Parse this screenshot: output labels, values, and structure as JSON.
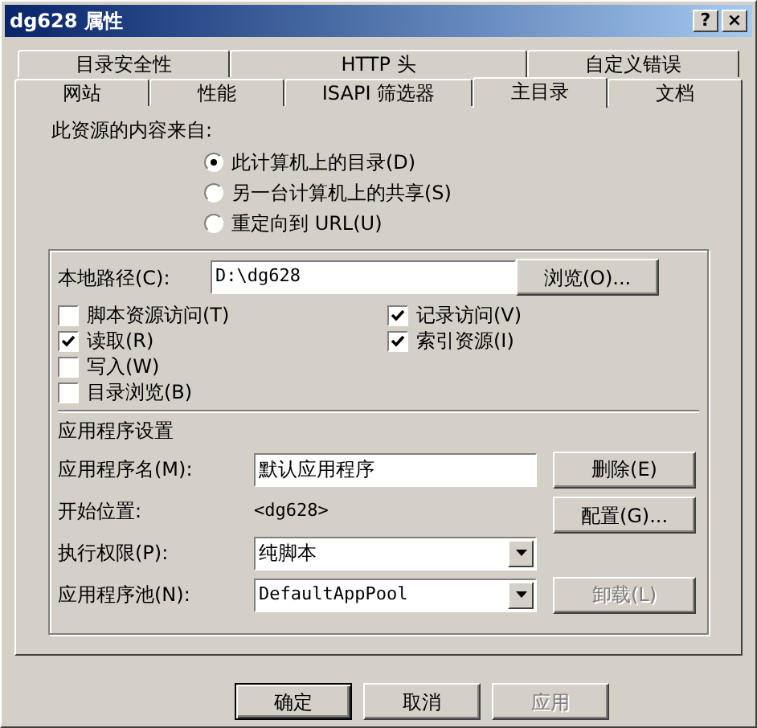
{
  "window": {
    "title": "dg628 属性",
    "controls": [
      "?",
      "×"
    ]
  },
  "tab_rows": [
    {
      "tabs": [
        {
          "label": "目录安全性",
          "selected": false
        },
        {
          "label": "HTTP 头",
          "selected": false
        },
        {
          "label": "自定义错误",
          "selected": false
        }
      ]
    },
    {
      "tabs": [
        {
          "label": "网站",
          "selected": false
        },
        {
          "label": "性能",
          "selected": false
        },
        {
          "label": "ISAPI 筛选器",
          "selected": false
        },
        {
          "label": "主目录",
          "selected": true
        },
        {
          "label": "文档",
          "selected": false
        }
      ]
    }
  ],
  "content_source": {
    "label": "此资源的内容来自:",
    "options": [
      {
        "label": "此计算机上的目录(D)",
        "selected": true
      },
      {
        "label": "另一台计算机上的共享(S)",
        "selected": false
      },
      {
        "label": "重定向到 URL(U)",
        "selected": false
      }
    ]
  },
  "local_path": {
    "label": "本地路径(C):",
    "value": "D:\\dg628",
    "browse_button": "浏览(O)..."
  },
  "left_checkboxes": [
    {
      "label": "脚本资源访问(T)",
      "checked": false
    },
    {
      "label": "读取(R)",
      "checked": true
    },
    {
      "label": "写入(W)",
      "checked": false
    },
    {
      "label": "目录浏览(B)",
      "checked": false
    }
  ],
  "right_checkboxes": [
    {
      "label": "记录访问(V)",
      "checked": true
    },
    {
      "label": "索引资源(I)",
      "checked": true
    }
  ],
  "app_settings": {
    "heading": "应用程序设置",
    "name": {
      "label": "应用程序名(M):",
      "value": "默认应用程序"
    },
    "delete_button": {
      "label": "删除(E)",
      "disabled": false
    },
    "start": {
      "label": "开始位置:",
      "value": "<dg628>"
    },
    "configure_button": {
      "label": "配置(G)...",
      "disabled": false
    },
    "exec": {
      "label": "执行权限(P):",
      "value": "纯脚本"
    },
    "pool": {
      "label": "应用程序池(N):",
      "value": "DefaultAppPool"
    },
    "unload_button": {
      "label": "卸载(L)",
      "disabled": true
    }
  },
  "footer_buttons": [
    {
      "label": "确定",
      "disabled": false,
      "default": true
    },
    {
      "label": "取消",
      "disabled": false,
      "default": false
    },
    {
      "label": "应用",
      "disabled": true,
      "default": false
    }
  ]
}
